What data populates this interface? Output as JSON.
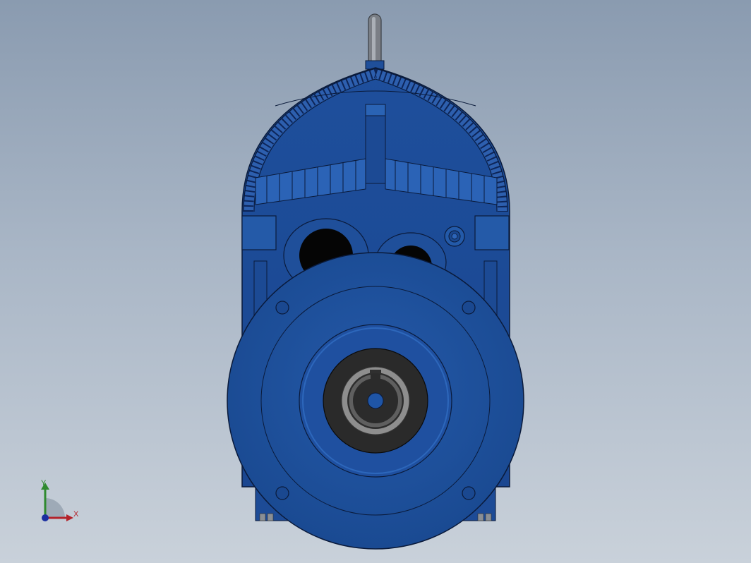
{
  "viewport": {
    "colors": {
      "bg_top": "#8a9bb0",
      "bg_bottom": "#c9d1da",
      "body": "#1f4f9a",
      "body_dark": "#163c79",
      "edge": "#0a1a3a"
    }
  },
  "model": {
    "name": "gear-reducer-front-view"
  },
  "triad": {
    "x_label": "X",
    "y_label": "Y",
    "colors": {
      "x": "#b3232b",
      "y": "#2f8a2f",
      "z": "#1b2fa0"
    }
  }
}
